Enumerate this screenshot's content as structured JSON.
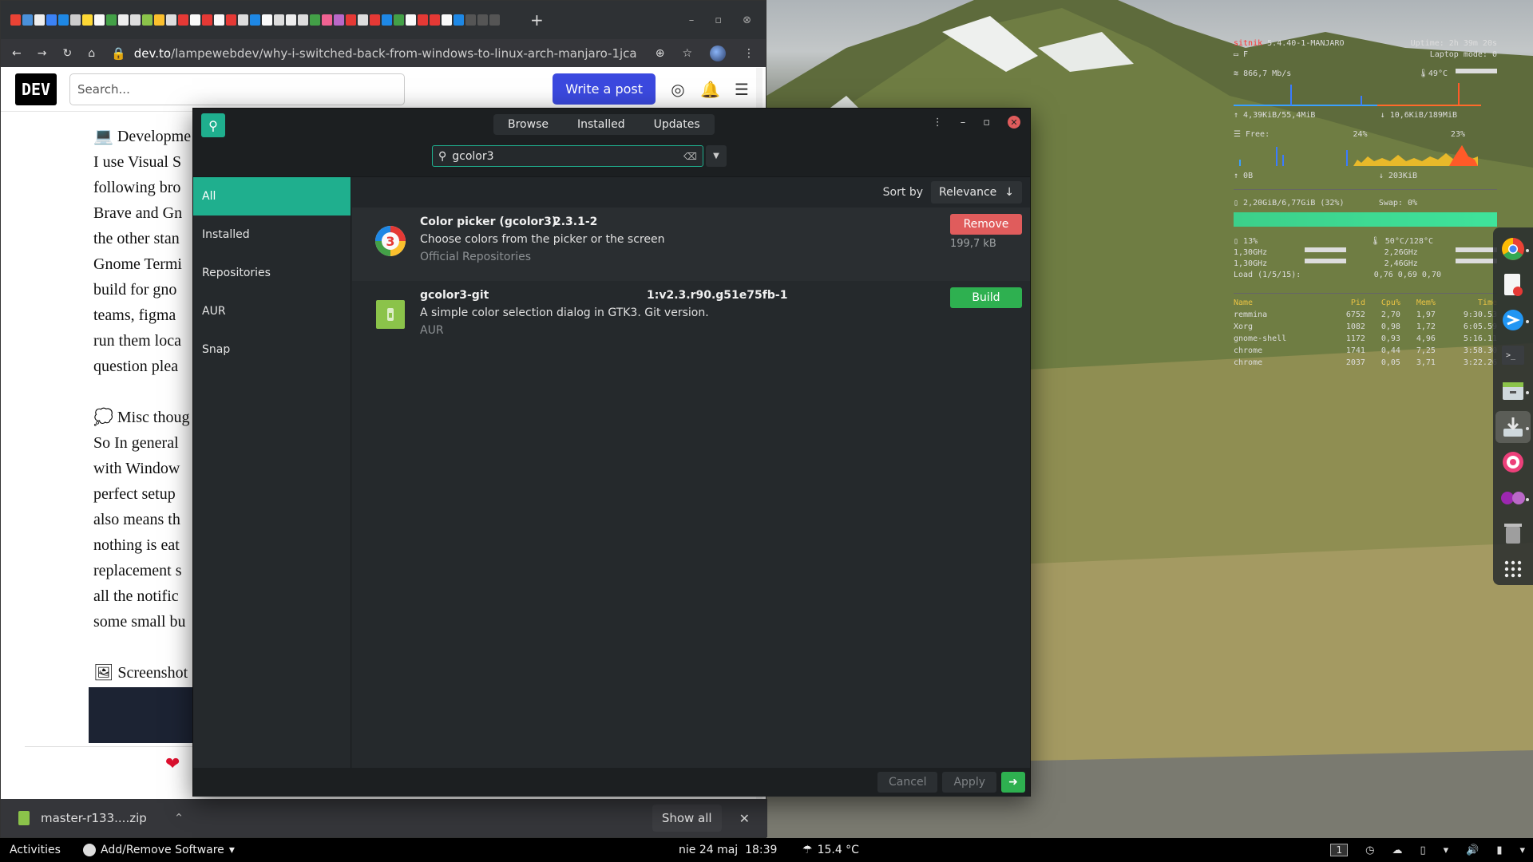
{
  "chrome": {
    "url_host": "dev.to",
    "url_path": "/lampewebdev/why-i-switched-back-from-windows-to-linux-arch-manjaro-1jca",
    "new_tab": "+"
  },
  "devto": {
    "logo": "DEV",
    "search_placeholder": "Search...",
    "write_post": "Write a post"
  },
  "article": {
    "lines": [
      "💻 Developme",
      "I use Visual S",
      "following bro",
      "Brave and Gn",
      "the other stan",
      "Gnome Termi",
      "build for gno",
      "teams, figma",
      "run them loca",
      "question plea",
      "",
      "💭 Misc thoug",
      "So In general",
      "with Window",
      "perfect setup",
      "also means th",
      "nothing is eat",
      "replacement s",
      "all the notific",
      "some small bu",
      "",
      "🖼 Screenshot"
    ]
  },
  "downloads": {
    "file": "master-r133....zip",
    "show_all": "Show all"
  },
  "pamac": {
    "tabs": [
      "Browse",
      "Installed",
      "Updates"
    ],
    "search_value": "gcolor3",
    "sidebar": [
      "All",
      "Installed",
      "Repositories",
      "AUR",
      "Snap"
    ],
    "sort_label": "Sort by",
    "sort_value": "Relevance",
    "packages": [
      {
        "name": "Color picker (gcolor3)",
        "version": "2.3.1-2",
        "description": "Choose colors from the picker or the screen",
        "repo": "Official Repositories",
        "size": "199,7 kB",
        "action": "Remove"
      },
      {
        "name": "gcolor3-git",
        "version": "1:v2.3.r90.g51e75fb-1",
        "description": "A simple color selection dialog in GTK3. Git version.",
        "repo": "AUR",
        "size": "",
        "action": "Build"
      }
    ],
    "footer": {
      "cancel": "Cancel",
      "apply": "Apply"
    }
  },
  "conky": {
    "host": "sitnik",
    "kernel": "5.4.40-1-MANJARO",
    "uptime": "Uptime: 2h 39m 20s",
    "battery": "F",
    "laptop_mode": "Laptop mode: 0",
    "wifi": "866,7 Mb/s",
    "temp": "49°C",
    "up": "4,39KiB/55,4MiB",
    "down": "10,6KiB/189MiB",
    "free": "Free:",
    "pct1": "24%",
    "pct2": "23%",
    "disk_r": "0B",
    "disk_w": "203KiB",
    "mem": "2,20GiB/6,77GiB (32%)",
    "swap": "Swap: 0%",
    "cpu_pct": "13%",
    "cpu_temp": "50°C/128°C",
    "freqs": [
      [
        "1,30GHz",
        "2,26GHz"
      ],
      [
        "1,30GHz",
        "2,46GHz"
      ]
    ],
    "load": "Load (1/5/15):",
    "load_vals": "0,76 0,69 0,70",
    "proc_headers": [
      "Name",
      "Pid",
      "Cpu%",
      "Mem%",
      "Time"
    ],
    "procs": [
      [
        "remmina",
        "6752",
        "2,70",
        "1,97",
        "9:30.53"
      ],
      [
        "Xorg",
        "1082",
        "0,98",
        "1,72",
        "6:05.59"
      ],
      [
        "gnome-shell",
        "1172",
        "0,93",
        "4,96",
        "5:16.11"
      ],
      [
        "chrome",
        "1741",
        "0,44",
        "7,25",
        "3:58.30"
      ],
      [
        "chrome",
        "2037",
        "0,05",
        "3,71",
        "3:22.26"
      ]
    ]
  },
  "panel": {
    "activities": "Activities",
    "app": "Add/Remove Software",
    "date": "nie 24 maj",
    "time": "18:39",
    "temp": "15.4 °C",
    "workspace": "1"
  }
}
